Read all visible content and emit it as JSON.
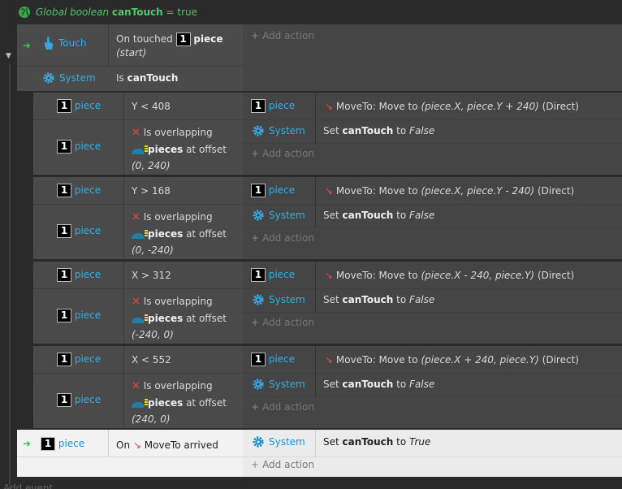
{
  "global_var": {
    "prefix": "Global boolean",
    "name": "canTouch",
    "value": "= true"
  },
  "top_event": {
    "cond1": {
      "object": "Touch",
      "text": "On touched",
      "piece": "piece",
      "note": "(start)"
    },
    "cond2": {
      "object": "System",
      "text": "Is",
      "var": "canTouch"
    },
    "add_action": "Add action"
  },
  "sub_events": [
    {
      "cond1": {
        "object": "piece",
        "text": "Y < 408"
      },
      "cond2": {
        "object": "piece",
        "text": "Is overlapping",
        "target": "pieces",
        "suffix": "at offset",
        "offset": "(0, 240)"
      },
      "act1": {
        "object": "piece",
        "text": "MoveTo: Move to",
        "args": "(piece.X, piece.Y + 240)",
        "tail": "(Direct)"
      },
      "act2": {
        "object": "System",
        "text": "Set",
        "var": "canTouch",
        "to": "to",
        "value": "False"
      },
      "add_action": "Add action"
    },
    {
      "cond1": {
        "object": "piece",
        "text": "Y > 168"
      },
      "cond2": {
        "object": "piece",
        "text": "Is overlapping",
        "target": "pieces",
        "suffix": "at offset",
        "offset": "(0, -240)"
      },
      "act1": {
        "object": "piece",
        "text": "MoveTo: Move to",
        "args": "(piece.X, piece.Y - 240)",
        "tail": "(Direct)"
      },
      "act2": {
        "object": "System",
        "text": "Set",
        "var": "canTouch",
        "to": "to",
        "value": "False"
      },
      "add_action": "Add action"
    },
    {
      "cond1": {
        "object": "piece",
        "text": "X > 312"
      },
      "cond2": {
        "object": "piece",
        "text": "Is overlapping",
        "target": "pieces",
        "suffix": "at offset",
        "offset": "(-240, 0)"
      },
      "act1": {
        "object": "piece",
        "text": "MoveTo: Move to",
        "args": "(piece.X - 240, piece.Y)",
        "tail": "(Direct)"
      },
      "act2": {
        "object": "System",
        "text": "Set",
        "var": "canTouch",
        "to": "to",
        "value": "False"
      },
      "add_action": "Add action"
    },
    {
      "cond1": {
        "object": "piece",
        "text": "X < 552"
      },
      "cond2": {
        "object": "piece",
        "text": "Is overlapping",
        "target": "pieces",
        "suffix": "at offset",
        "offset": "(240, 0)"
      },
      "act1": {
        "object": "piece",
        "text": "MoveTo: Move to",
        "args": "(piece.X + 240, piece.Y)",
        "tail": "(Direct)"
      },
      "act2": {
        "object": "System",
        "text": "Set",
        "var": "canTouch",
        "to": "to",
        "value": "False"
      },
      "add_action": "Add action"
    }
  ],
  "bottom_event": {
    "cond": {
      "object": "piece",
      "prefix": "On",
      "text": "MoveTo arrived"
    },
    "act": {
      "object": "System",
      "text": "Set",
      "var": "canTouch",
      "to": "to",
      "value": "True"
    },
    "add_action": "Add action"
  },
  "add_event": "Add event",
  "badge_number": "1",
  "colors": {
    "accent_green": "#52c66a",
    "object_blue": "#31aee6",
    "warn_red": "#e04848"
  }
}
